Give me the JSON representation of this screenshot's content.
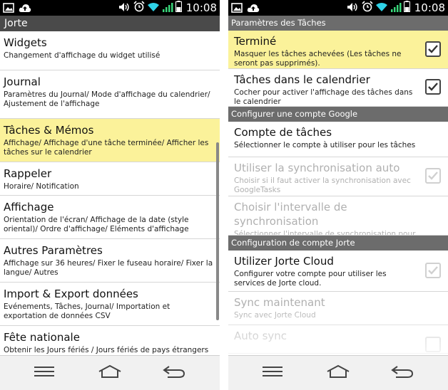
{
  "left": {
    "status_time": "10:08",
    "app_title": "Jorte",
    "items": [
      {
        "title": "Widgets",
        "subtitle": "Changement d'affichage du widget utilisé"
      },
      {
        "title": "Journal",
        "subtitle": "Paramètres du Journal/ Mode d'affichage du calendrier/ Ajustement de l'affichage"
      },
      {
        "title": "Tâches & Mémos",
        "subtitle": "Affichage/ Affichage d'une tâche terminée/ Afficher les tâches sur le calendrier"
      },
      {
        "title": "Rappeler",
        "subtitle": "Horaire/ Notification"
      },
      {
        "title": "Affichage",
        "subtitle": "Orientation de l'écran/ Affichage de la date (style oriental)/ Ordre d'affichage/ Eléments d'affichage"
      },
      {
        "title": "Autres Paramètres",
        "subtitle": "Affichage sur 36 heures/ Fixer le fuseau horaire/ Fixer la langue/ Autres"
      },
      {
        "title": "Import & Export données",
        "subtitle": "Evénements, Tâches, Journal/ Importation et exportation de données CSV"
      },
      {
        "title": "Fête nationale",
        "subtitle": "Obtenir les Jours fériés / Jours fériés de pays étrangers"
      }
    ]
  },
  "right": {
    "status_time": "10:08",
    "sections": [
      {
        "header": "Paramètres des Tâches",
        "items": [
          {
            "title": "Terminé",
            "subtitle": "Masquer les tâches achevées (Les tâches ne seront pas supprimés)."
          },
          {
            "title": "Tâches dans le calendrier",
            "subtitle": "Cocher pour activer l'affichage des tâches dans le calendrier"
          }
        ]
      },
      {
        "header": "Configurer une compte Google",
        "items": [
          {
            "title": "Compte de tâches",
            "subtitle": "Sélectionner le compte à utiliser pour les tâches"
          },
          {
            "title": "Utiliser la synchronisation auto",
            "subtitle": "Choisir si il faut activer la synchronisation avec GoogleTasks"
          },
          {
            "title": "Choisir l'intervalle de synchronisation",
            "subtitle": "Sélectionner l'intervalle de synchronisation pour Google Tasks"
          }
        ]
      },
      {
        "header": "Configuration de compte Jorte",
        "items": [
          {
            "title": "Utilizer Jorte Cloud",
            "subtitle": "Configurer votre compte pour utiliser les services de Jorte cloud."
          },
          {
            "title": "Sync maintenant",
            "subtitle": "Sync avec Jorte Cloud"
          },
          {
            "title": "Auto sync",
            "subtitle": ""
          }
        ]
      }
    ]
  },
  "colors": {
    "highlight": "#fbf29a",
    "section_header": "#6c6c6c",
    "statusbar": "#000000",
    "wifi": "#2fd3e8",
    "signal": "#39d67a"
  },
  "icons": [
    "image-icon",
    "cloud-upload-icon",
    "volume-icon",
    "alarm-icon",
    "wifi-icon",
    "signal-icon",
    "battery-icon",
    "menu-icon",
    "home-icon",
    "back-icon",
    "checkbox-icon"
  ]
}
